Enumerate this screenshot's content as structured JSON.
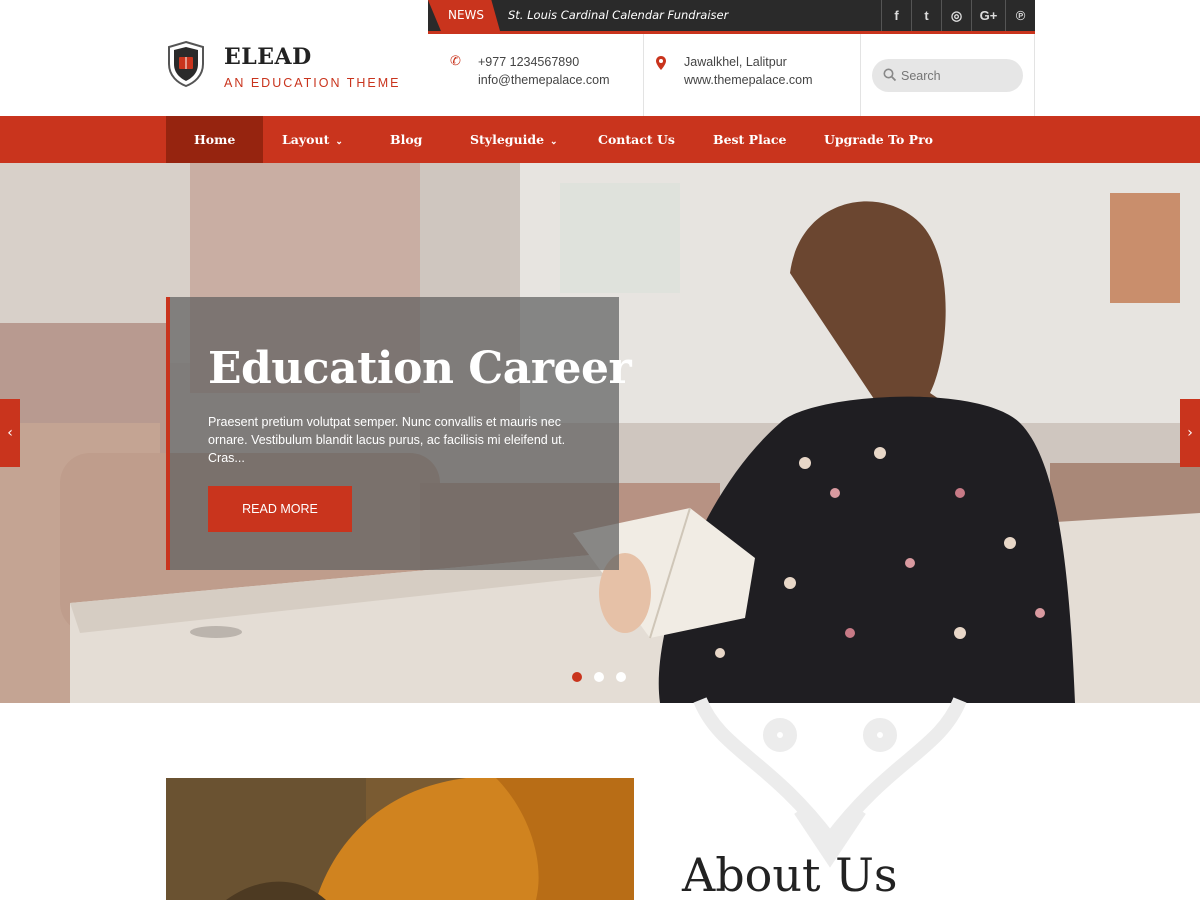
{
  "topbar": {
    "news_label": "NEWS",
    "news_text": "St. Louis Cardinal Calendar Fundraiser",
    "social_icons": [
      "facebook-icon",
      "twitter-icon",
      "instagram-icon",
      "google-plus-icon",
      "pinterest-icon"
    ],
    "social_glyphs": [
      "f",
      "t",
      "◎",
      "G+",
      "℗"
    ]
  },
  "header": {
    "brand": "ELEAD",
    "tagline": "AN EDUCATION THEME",
    "phone": "+977 1234567890",
    "email": "info@themepalace.com",
    "address": "Jawalkhel, Lalitpur",
    "website": "www.themepalace.com",
    "search_placeholder": "Search"
  },
  "nav": {
    "items": [
      {
        "label": "Home",
        "active": true
      },
      {
        "label": "Layout",
        "dropdown": true
      },
      {
        "label": "Blog"
      },
      {
        "label": "Styleguide",
        "dropdown": true
      },
      {
        "label": "Contact Us"
      },
      {
        "label": "Best Place"
      },
      {
        "label": "Upgrade To Pro"
      }
    ]
  },
  "hero": {
    "title": "Education Career",
    "text": "Praesent pretium volutpat semper. Nunc convallis et mauris nec ornare. Vestibulum blandit lacus purus, ac facilisis mi eleifend ut. Cras...",
    "button": "READ MORE",
    "prev_glyph": "‹",
    "next_glyph": "›",
    "slides": 3,
    "active_slide": 1
  },
  "about": {
    "title": "About Us"
  },
  "colors": {
    "accent": "#c9341d",
    "accent_dark": "#96240f",
    "topbar": "#2a2a2a"
  }
}
